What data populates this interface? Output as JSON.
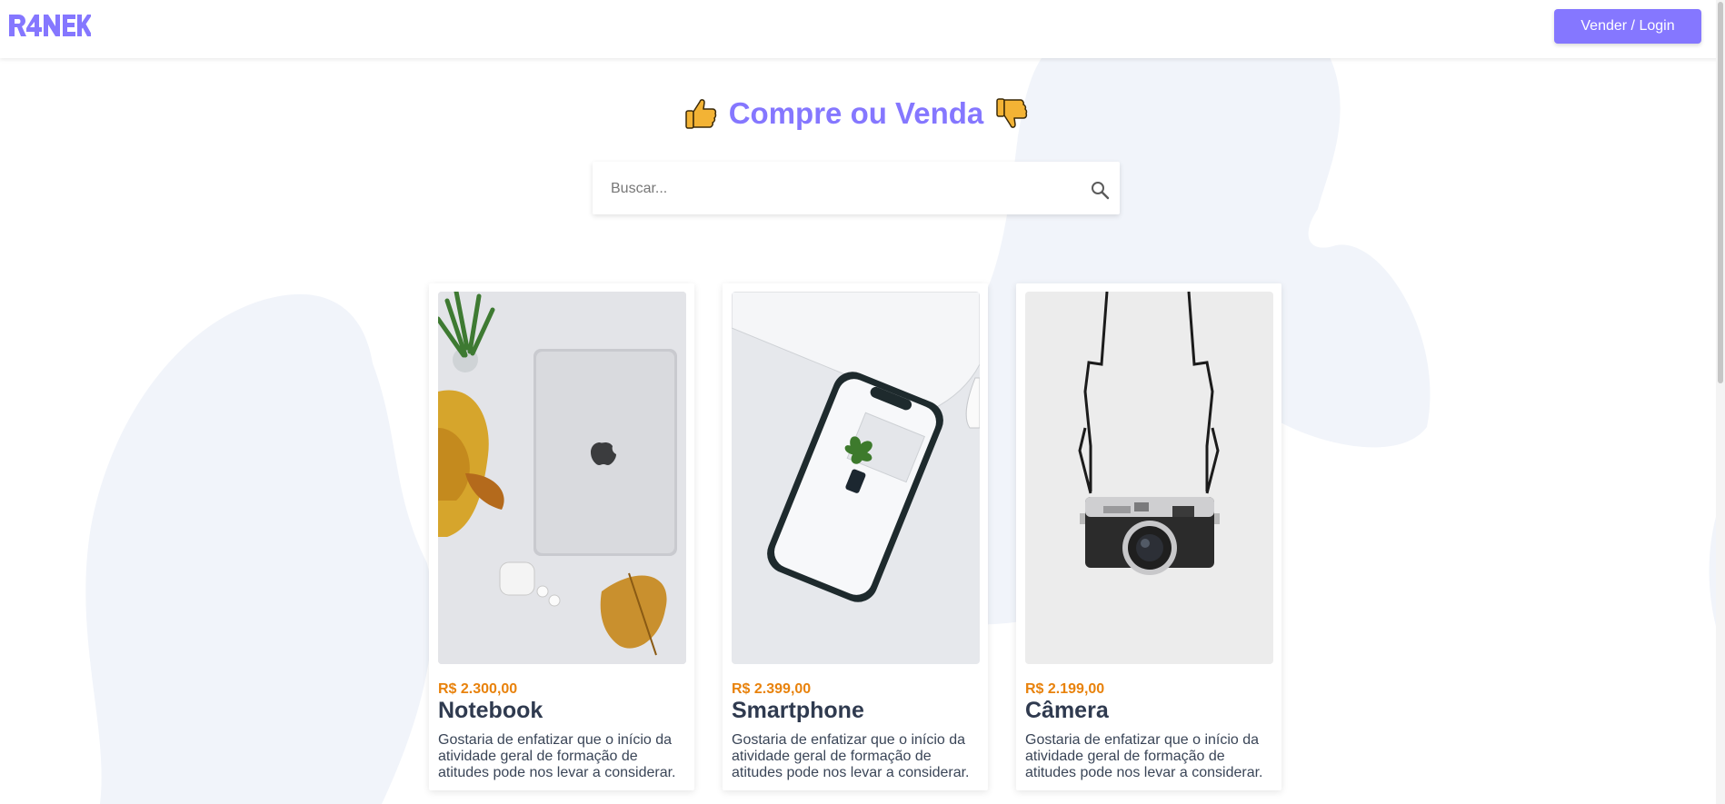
{
  "colors": {
    "accent": "#8577ff",
    "price": "#e8820c",
    "text": "#2f3a4f",
    "blob": "#f1f4fa"
  },
  "header": {
    "logo_text": "RANEK",
    "login_button": "Vender / Login"
  },
  "hero": {
    "title": "Compre ou Venda",
    "left_icon": "thumbs-up-icon",
    "right_icon": "thumbs-down-icon"
  },
  "search": {
    "placeholder": "Buscar...",
    "value": "",
    "icon": "search-icon"
  },
  "products": [
    {
      "price": "R$ 2.300,00",
      "name": "Notebook",
      "description": "Gostaria de enfatizar que o início da atividade geral de formação de atitudes pode nos levar a considerar."
    },
    {
      "price": "R$ 2.399,00",
      "name": "Smartphone",
      "description": "Gostaria de enfatizar que o início da atividade geral de formação de atitudes pode nos levar a considerar."
    },
    {
      "price": "R$ 2.199,00",
      "name": "Câmera",
      "description": "Gostaria de enfatizar que o início da atividade geral de formação de atitudes pode nos levar a considerar."
    }
  ]
}
